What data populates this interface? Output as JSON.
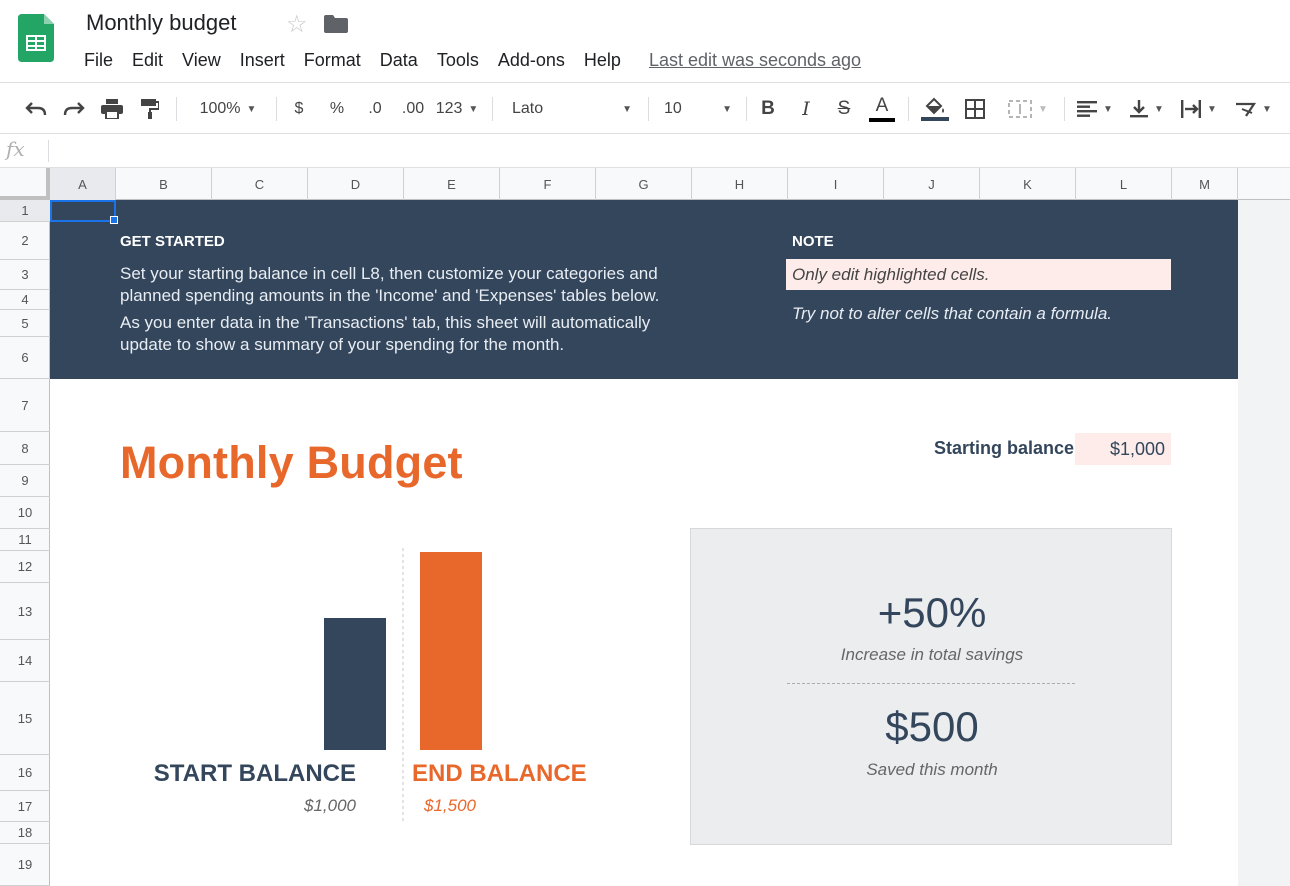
{
  "app": {
    "doc_title": "Monthly budget",
    "menu": [
      "File",
      "Edit",
      "View",
      "Insert",
      "Format",
      "Data",
      "Tools",
      "Add-ons",
      "Help"
    ],
    "last_edit": "Last edit was seconds ago"
  },
  "toolbar": {
    "zoom": "100%",
    "currency": "$",
    "percent": "%",
    "decrease_decimals": ".0",
    "increase_decimals": ".00",
    "more_formats": "123",
    "font": "Lato",
    "font_size": "10",
    "bold": "B",
    "italic": "I",
    "strike": "S",
    "text_color": "A"
  },
  "formula_bar": {
    "fx": "fx"
  },
  "columns": [
    "A",
    "B",
    "C",
    "D",
    "E",
    "F",
    "G",
    "H",
    "I",
    "J",
    "K",
    "L",
    "M"
  ],
  "rows": [
    "1",
    "2",
    "3",
    "4",
    "5",
    "6",
    "7",
    "8",
    "9",
    "10",
    "11",
    "12",
    "13",
    "14",
    "15",
    "16",
    "17",
    "18",
    "19"
  ],
  "banner": {
    "get_started_heading": "GET STARTED",
    "get_started_line1": "Set your starting balance in cell L8, then customize your categories and",
    "get_started_line2": "planned spending amounts in the 'Income' and 'Expenses' tables below.",
    "get_started_line3": "As you enter data in the 'Transactions' tab, this sheet will automatically",
    "get_started_line4": "update to show a summary of your spending for the month.",
    "note_heading": "NOTE",
    "note_line1": "Only edit highlighted cells.",
    "note_line2": "Try not to alter cells that contain a formula."
  },
  "main": {
    "title": "Monthly Budget",
    "starting_balance_label": "Starting balance:",
    "starting_balance_value": "$1,000"
  },
  "chart_data": {
    "type": "bar",
    "categories": [
      "START BALANCE",
      "END BALANCE"
    ],
    "values": [
      1000,
      1500
    ],
    "value_labels": [
      "$1,000",
      "$1,500"
    ],
    "colors": [
      "#34465c",
      "#e8682c"
    ]
  },
  "summary": {
    "percent": "+50%",
    "percent_caption": "Increase in total savings",
    "saved": "$500",
    "saved_caption": "Saved this month"
  },
  "colors": {
    "banner": "#34465c",
    "accent": "#e8682c",
    "highlight": "#fdecea",
    "card": "#ebedef"
  }
}
